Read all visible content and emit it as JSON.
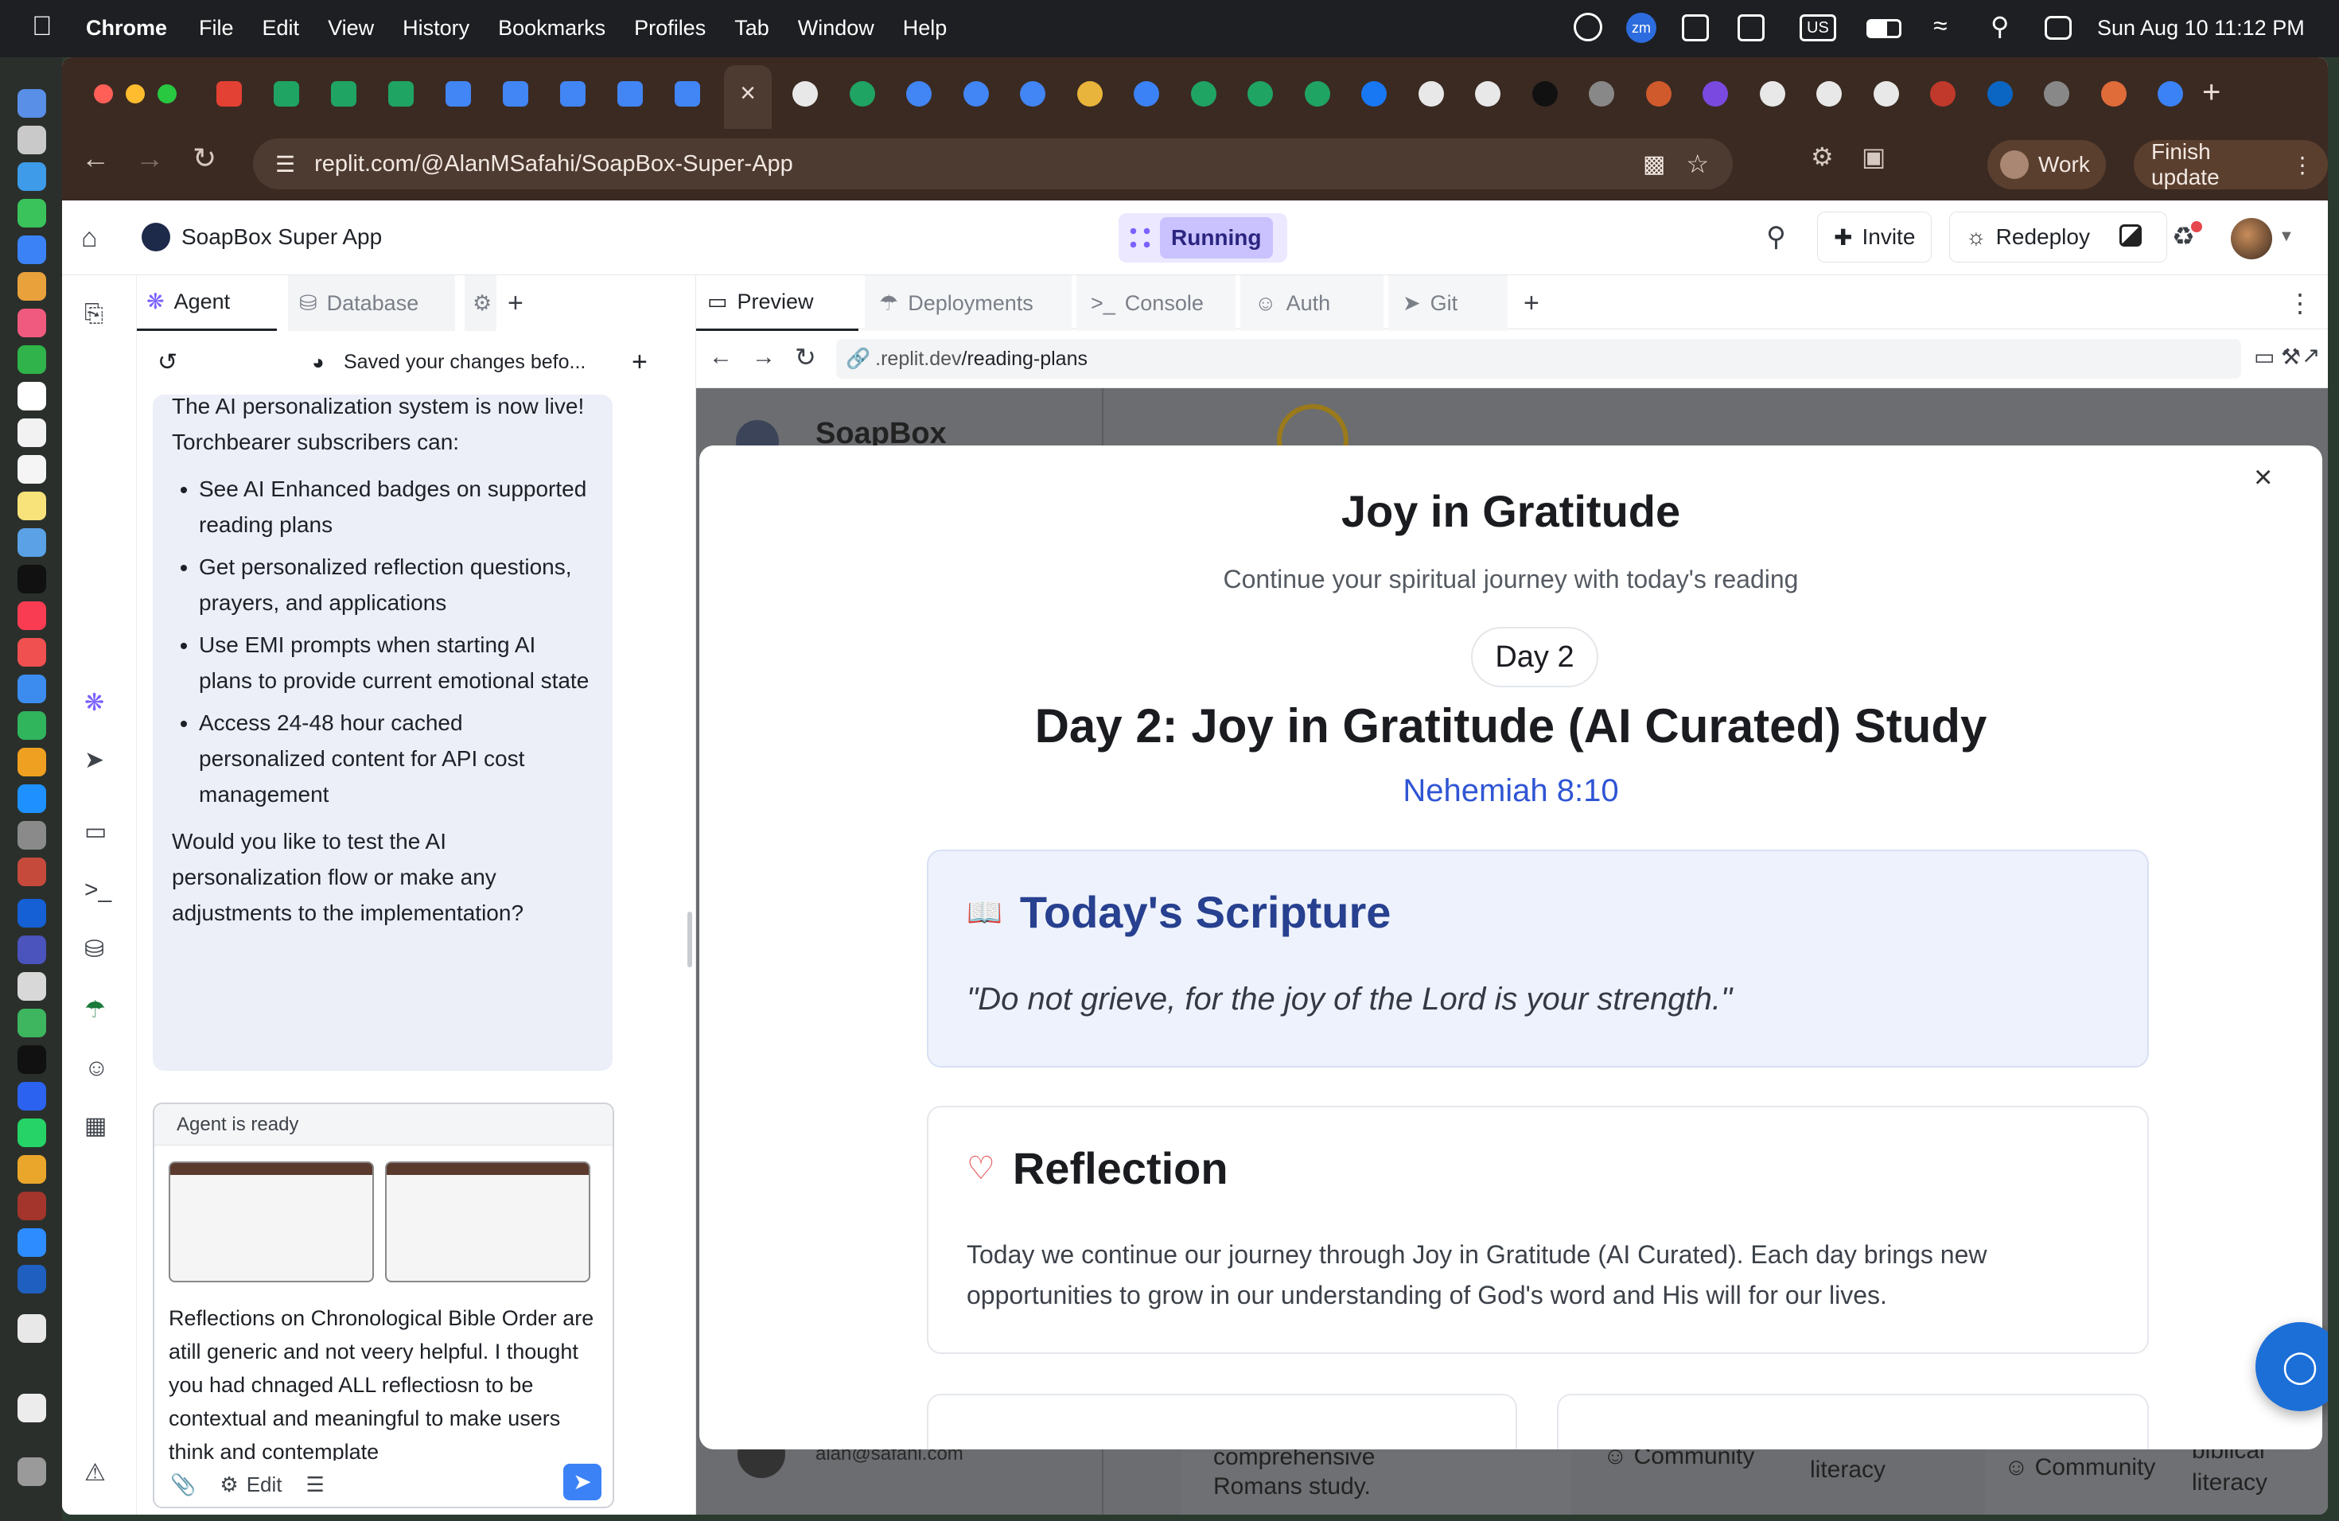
{
  "menubar": {
    "app": "Chrome",
    "items": [
      "File",
      "Edit",
      "View",
      "History",
      "Bookmarks",
      "Profiles",
      "Tab",
      "Window",
      "Help"
    ],
    "status_zoom": "zm",
    "status_input": "US",
    "datetime": "Sun Aug 10  11:12 PM"
  },
  "browser": {
    "url": "replit.com/@AlanMSafahi/SoapBox-Super-App",
    "profile_label": "Work",
    "update_label": "Finish update"
  },
  "replit": {
    "project_name": "SoapBox Super App",
    "run_status": "Running",
    "invite_label": "Invite",
    "redeploy_label": "Redeploy",
    "left_tabs": [
      "Agent",
      "Database"
    ],
    "checkpoint_text": "Saved your changes befo...",
    "chat": {
      "intro": "The AI personalization system is now live! Torchbearer subscribers can:",
      "bullets": [
        "See AI Enhanced badges on supported reading plans",
        "Get personalized reflection questions, prayers, and applications",
        "Use EMI prompts when starting AI plans to provide current emotional state",
        "Access 24-48 hour cached personalized content for API cost management"
      ],
      "closing": "Would you like to test the AI personalization flow or make any adjustments to the implementation?"
    },
    "agent_status": "Agent is ready",
    "draft_message": "Reflections on Chronological Bible Order are atill generic and not veery helpful. I thought you had chnaged ALL reflectiosn to be contextual and meaningful to make users think and contemplate",
    "edit_label": "Edit",
    "preview_tabs": [
      "Preview",
      "Deployments",
      "Console",
      "Auth",
      "Git"
    ],
    "preview_url_prefix": ".replit.dev",
    "preview_url_path": "/reading-plans"
  },
  "site": {
    "brand": "SoapBox",
    "bg_email": "alan@safahi.com",
    "bg_card1_text1": "comprehensive",
    "bg_card1_text2": "Romans study.",
    "bg_tag_community": "Community",
    "bg_tag_biblical": "biblical",
    "bg_tag_literacy": "literacy"
  },
  "modal": {
    "title": "Joy in Gratitude",
    "subtitle": "Continue your spiritual journey with today's reading",
    "day_badge": "Day 2",
    "heading": "Day 2: Joy in Gratitude (AI Curated) Study",
    "reference": "Nehemiah 8:10",
    "scripture_title": "Today's Scripture",
    "scripture_text": "\"Do not grieve, for the joy of the Lord is your strength.\"",
    "reflection_title": "Reflection",
    "reflection_text": "Today we continue our journey through Joy in Gratitude (AI Curated). Each day brings new opportunities to grow in our understanding of God's word and His will for our lives."
  },
  "colors": {
    "accent_purple": "#7b61ff",
    "running_bg": "#c9c2ff",
    "scripture_blue": "#27408f",
    "reference_blue": "#2f55d4",
    "heart_red": "#e5484d",
    "chat_bg": "#eceef8"
  }
}
